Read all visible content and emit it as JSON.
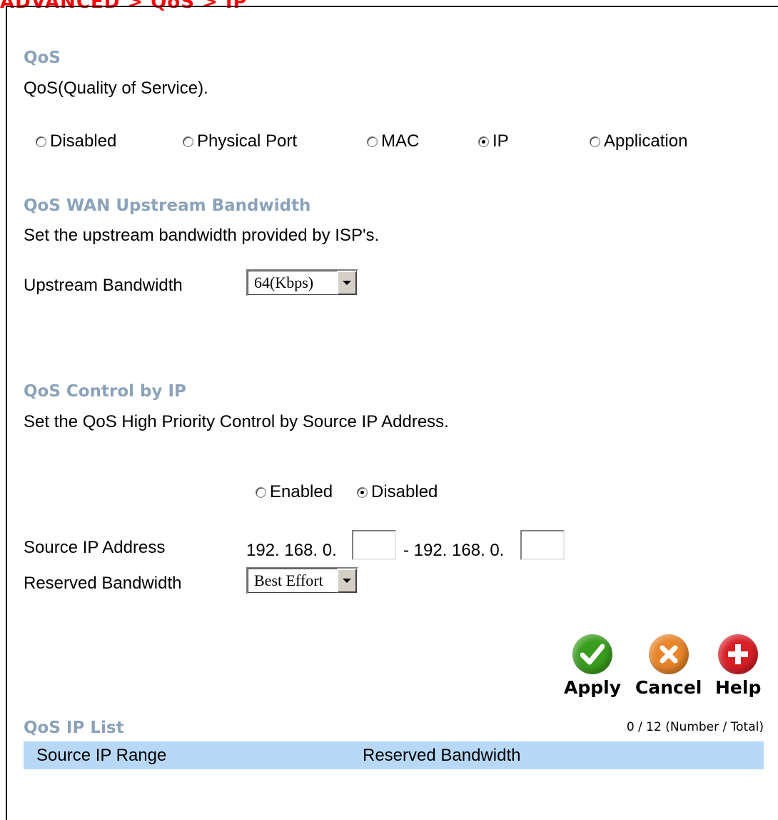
{
  "breadcrumb": "ADVANCED > QoS > IP",
  "qos": {
    "heading": "QoS",
    "description": "QoS(Quality of Service).",
    "options": [
      {
        "label": "Disabled",
        "checked": false
      },
      {
        "label": "Physical Port",
        "checked": false
      },
      {
        "label": "MAC",
        "checked": false
      },
      {
        "label": "IP",
        "checked": true
      },
      {
        "label": "Application",
        "checked": false
      }
    ]
  },
  "upstream": {
    "heading": "QoS WAN Upstream Bandwidth",
    "description": "Set the upstream bandwidth provided by ISP's.",
    "field_label": "Upstream Bandwidth",
    "selected": "64(Kbps)"
  },
  "control": {
    "heading": "QoS Control by IP",
    "description": "Set the QoS High Priority Control by Source IP Address.",
    "enabled_label": "Enabled",
    "disabled_label": "Disabled",
    "enabled_checked": false,
    "disabled_checked": true,
    "source_ip_label": "Source IP Address",
    "ip_prefix_start": "192. 168. 0.",
    "ip_separator": "- 192. 168. 0.",
    "ip_start_value": "",
    "ip_end_value": "",
    "reserved_label": "Reserved Bandwidth",
    "reserved_selected": "Best Effort"
  },
  "actions": {
    "apply": "Apply",
    "cancel": "Cancel",
    "help": "Help"
  },
  "ip_list": {
    "heading": "QoS IP List",
    "count": "0 / 12 (Number / Total)",
    "columns": [
      "Source IP Range",
      "Reserved Bandwidth"
    ]
  },
  "colors": {
    "breadcrumb": "#ff0000",
    "heading": "#8ba2ba",
    "list_header_bg": "#b7d9f7",
    "apply_icon": "#3a9c1e",
    "cancel_icon": "#e8842a",
    "help_icon": "#d81f26"
  },
  "icons": {
    "apply": "checkmark-icon",
    "cancel": "x-icon",
    "help": "plus-icon"
  }
}
